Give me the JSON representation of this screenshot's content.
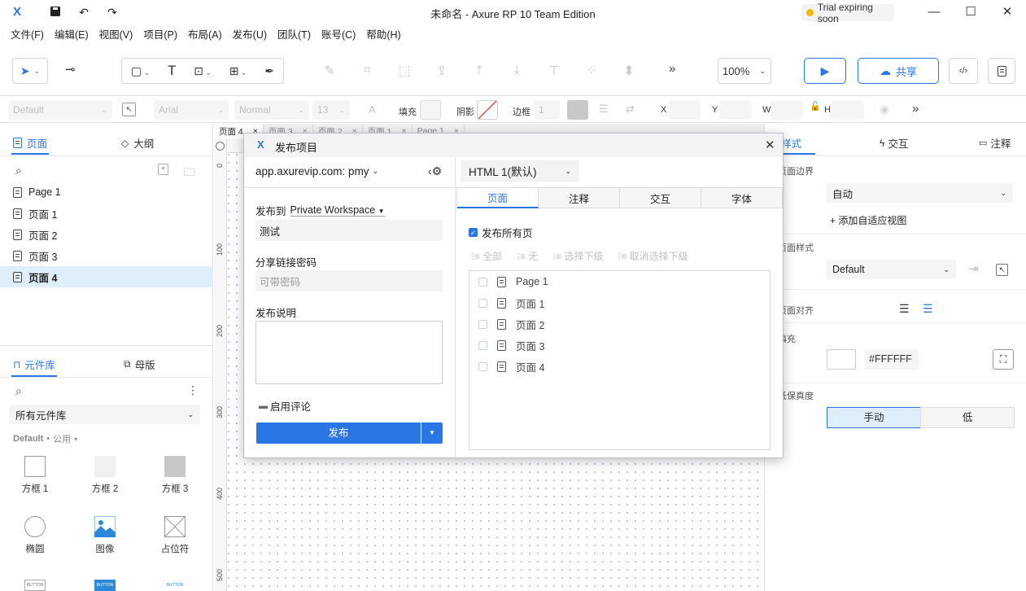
{
  "window": {
    "title": "未命名 - Axure RP 10 Team Edition",
    "trial_label": "Trial expiring soon",
    "logo": "X"
  },
  "menu": [
    "文件(F)",
    "编辑(E)",
    "视图(V)",
    "项目(P)",
    "布局(A)",
    "发布(U)",
    "团队(T)",
    "账号(C)",
    "帮助(H)"
  ],
  "toolbar": {
    "zoom": "100%",
    "share_label": "共享",
    "more": "»"
  },
  "stylebar": {
    "style_select": "Default",
    "font_select": "Arial",
    "weight_select": "Normal",
    "size_select": "13",
    "fill_label": "填充",
    "shadow_label": "阴影",
    "border_label": "边框",
    "border_value": "1",
    "x_label": "X",
    "y_label": "Y",
    "w_label": "W",
    "h_label": "H"
  },
  "pages_panel": {
    "tab_pages": "页面",
    "tab_outline": "大纲",
    "items": [
      "Page 1",
      "页面 1",
      "页面 2",
      "页面 3",
      "页面 4"
    ],
    "selected_index": 4
  },
  "library_panel": {
    "tab_library": "元件库",
    "tab_masters": "母版",
    "library_select": "所有元件库",
    "group_label": "Default",
    "group_sub": "公用",
    "items": [
      "方框 1",
      "方框 2",
      "方框 3",
      "椭圆",
      "图像",
      "占位符"
    ],
    "button_labels": [
      "BUTTON",
      "BUTTON",
      "BUTTON"
    ]
  },
  "canvas": {
    "tabs": [
      "页面 4",
      "页面 3",
      "页面 2",
      "页面 1",
      "Page 1"
    ],
    "ruler_marks": [
      "0",
      "100",
      "200",
      "300",
      "400",
      "500"
    ]
  },
  "right_panel": {
    "tab_style": "样式",
    "tab_interact": "交互",
    "tab_notes": "注释",
    "page_bounds_label": "页面边界",
    "page_bounds_value": "自动",
    "add_adaptive": "+ 添加自适应视图",
    "page_style_label": "页面样式",
    "page_style_value": "Default",
    "page_align_label": "页面对齐",
    "fill_label": "填充",
    "fill_color": "#FFFFFF",
    "fidelity_label": "低保真度",
    "fidelity_manual": "手动",
    "fidelity_low": "低"
  },
  "dialog": {
    "title": "发布项目",
    "server": "app.axurevip.com: pmy",
    "publish_to_label": "发布到",
    "workspace": "Private Workspace",
    "project_name": "测试",
    "password_label": "分享链接密码",
    "password_placeholder": "可带密码",
    "desc_label": "发布说明",
    "enable_comments": "启用评论",
    "publish_button": "发布",
    "format_select": "HTML 1(默认)",
    "tabs": [
      "页面",
      "注释",
      "交互",
      "字体"
    ],
    "publish_all_label": "发布所有页",
    "actions": [
      "全部",
      "无",
      "选择下级",
      "取消选择下级"
    ],
    "pages": [
      "Page 1",
      "页面 1",
      "页面 2",
      "页面 3",
      "页面 4"
    ]
  },
  "colors": {
    "accent": "#2B76E5",
    "selection": "#DFEEFB",
    "trial_dot": "#F5B800"
  }
}
